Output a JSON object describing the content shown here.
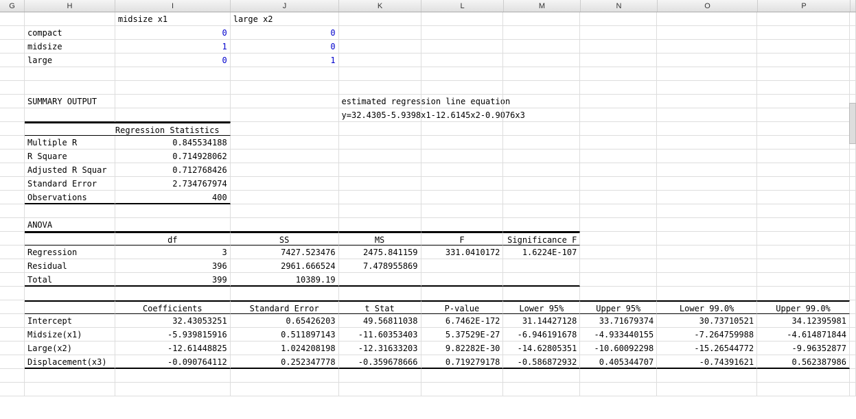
{
  "colHeaders": [
    "G",
    "H",
    "I",
    "J",
    "K",
    "L",
    "M",
    "N",
    "O",
    "P",
    ""
  ],
  "hdrRow": {
    "I": "midsize x1",
    "J": "large x2"
  },
  "dummy": [
    {
      "H": "compact",
      "I": "0",
      "J": "0"
    },
    {
      "H": "midsize",
      "I": "1",
      "J": "0"
    },
    {
      "H": "large",
      "I": "0",
      "J": "1"
    }
  ],
  "summaryLabel": "SUMMARY OUTPUT",
  "eqLabel": "estimated regression line equation",
  "eq": "y=32.4305-5.9398x1-12.6145x2-0.9076x3",
  "regStatsTitle": "Regression Statistics",
  "regStats": [
    {
      "k": "Multiple R",
      "v": "0.845534188"
    },
    {
      "k": "R Square",
      "v": "0.714928062"
    },
    {
      "k": "Adjusted R Squar",
      "v": "0.712768426"
    },
    {
      "k": "Standard Error",
      "v": "2.734767974"
    },
    {
      "k": "Observations",
      "v": "400"
    }
  ],
  "anovaLabel": "ANOVA",
  "anovaHdr": {
    "I": "df",
    "J": "SS",
    "K": "MS",
    "L": "F",
    "M": "Significance F"
  },
  "anova": [
    {
      "H": "Regression",
      "I": "3",
      "J": "7427.523476",
      "K": "2475.841159",
      "L": "331.0410172",
      "M": "1.6224E-107"
    },
    {
      "H": "Residual",
      "I": "396",
      "J": "2961.666524",
      "K": "7.478955869",
      "L": "",
      "M": ""
    },
    {
      "H": "Total",
      "I": "399",
      "J": "10389.19",
      "K": "",
      "L": "",
      "M": ""
    }
  ],
  "coefHdr": {
    "I": "Coefficients",
    "J": "Standard Error",
    "K": "t Stat",
    "L": "P-value",
    "M": "Lower 95%",
    "N": "Upper 95%",
    "O": "Lower 99.0%",
    "P": "Upper 99.0%"
  },
  "coef": [
    {
      "H": "Intercept",
      "I": "32.43053251",
      "J": "0.65426203",
      "K": "49.56811038",
      "L": "6.7462E-172",
      "M": "31.14427128",
      "N": "33.71679374",
      "O": "30.73710521",
      "P": "34.12395981"
    },
    {
      "H": "Midsize(x1)",
      "I": "-5.939815916",
      "J": "0.511897143",
      "K": "-11.60353403",
      "L": "5.37529E-27",
      "M": "-6.946191678",
      "N": "-4.933440155",
      "O": "-7.264759988",
      "P": "-4.614871844"
    },
    {
      "H": "Large(x2)",
      "I": "-12.61448825",
      "J": "1.024208198",
      "K": "-12.31633203",
      "L": "9.82282E-30",
      "M": "-14.62805351",
      "N": "-10.60092298",
      "O": "-15.26544772",
      "P": "-9.96352877"
    },
    {
      "H": "Displacement(x3)",
      "I": "-0.090764112",
      "J": "0.252347778",
      "K": "-0.359678666",
      "L": "0.719279178",
      "M": "-0.586872932",
      "N": "0.405344707",
      "O": "-0.74391621",
      "P": "0.562387986"
    }
  ]
}
